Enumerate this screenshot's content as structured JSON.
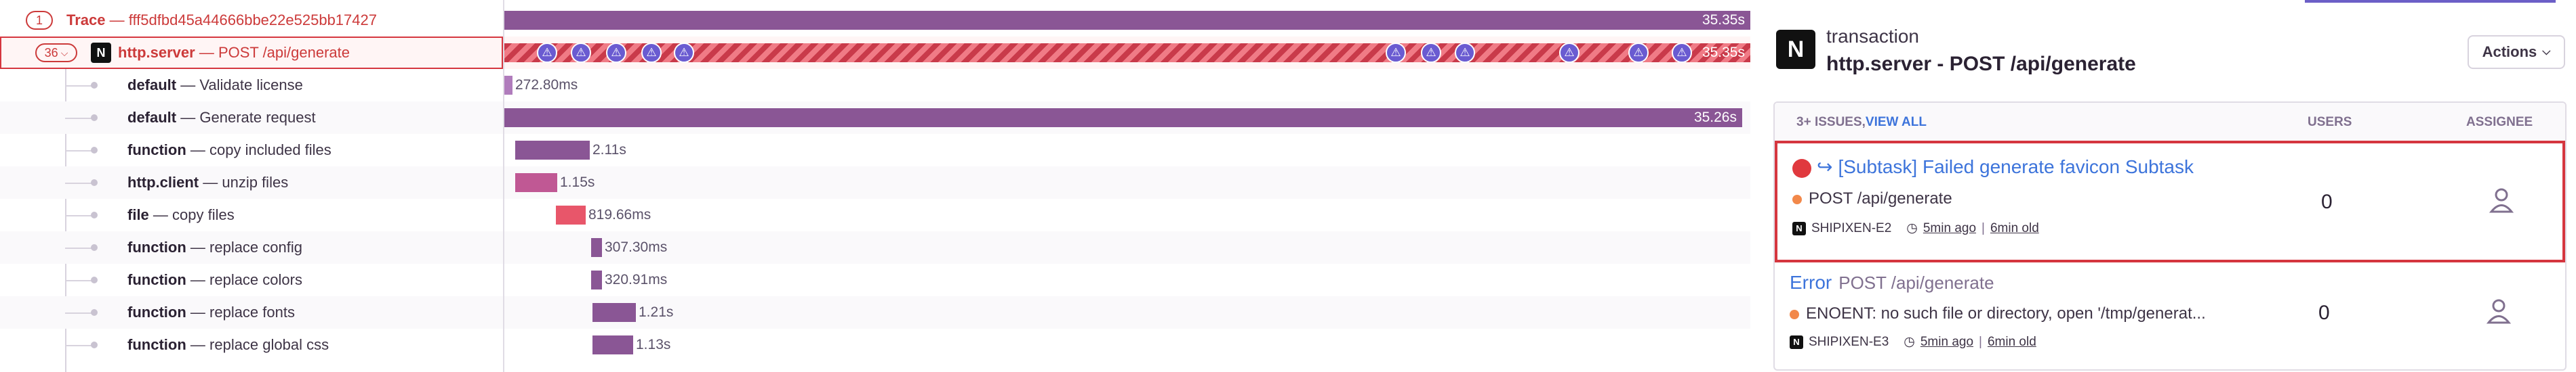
{
  "tree": {
    "trace_count": "1",
    "trace_label": "Trace",
    "trace_id": "fff5dfbd45a44666bbe22e525bb17427",
    "root_count": "36",
    "root_op": "http.server",
    "root_desc": "POST /api/generate",
    "spans": [
      {
        "op": "default",
        "desc": "Validate license"
      },
      {
        "op": "default",
        "desc": "Generate request"
      },
      {
        "op": "function",
        "desc": "copy included files"
      },
      {
        "op": "http.client",
        "desc": "unzip files"
      },
      {
        "op": "file",
        "desc": "copy files"
      },
      {
        "op": "function",
        "desc": "replace config"
      },
      {
        "op": "function",
        "desc": "replace colors"
      },
      {
        "op": "function",
        "desc": "replace fonts"
      },
      {
        "op": "function",
        "desc": "replace global css"
      }
    ]
  },
  "waterfall": {
    "trace_duration": "35.35s",
    "root_duration": "35.35s",
    "span_durations": [
      "272.80ms",
      "35.26s",
      "2.11s",
      "1.15s",
      "819.66ms",
      "307.30ms",
      "320.91ms",
      "1.21s",
      "1.13s"
    ],
    "colors": {
      "purple": "#8a5695",
      "pink": "#c05894",
      "red": "#e8566a",
      "light_purple": "#b07cbc"
    }
  },
  "panel": {
    "kind": "transaction",
    "title": "http.server - POST /api/generate",
    "actions_label": "Actions",
    "issues_header": "3+ ISSUES,",
    "view_all": "VIEW ALL",
    "users_header": "USERS",
    "assignee_header": "ASSIGNEE",
    "issues": [
      {
        "title": "[Subtask] Failed generate favicon Subtask",
        "subtitle": "POST /api/generate",
        "project": "SHIPIXEN-E2",
        "last_seen": "5min ago",
        "age": "6min old",
        "users": "0"
      },
      {
        "title": "Error",
        "title_suffix": "POST /api/generate",
        "subtitle": "ENOENT: no such file or directory, open '/tmp/generat...",
        "project": "SHIPIXEN-E3",
        "last_seen": "5min ago",
        "age": "6min old",
        "users": "0"
      }
    ]
  }
}
